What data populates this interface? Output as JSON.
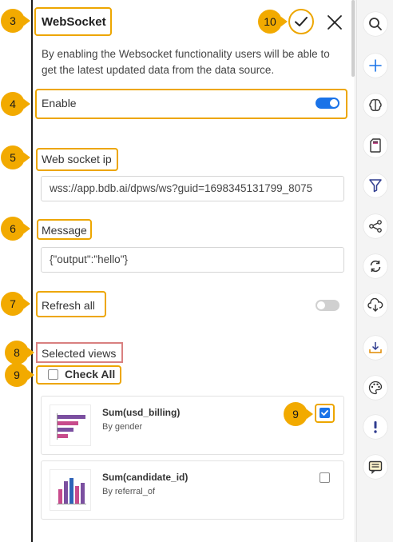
{
  "panel": {
    "title": "WebSocket",
    "description": "By enabling the Websocket functionality users will be able to get the latest updated data from the data source.",
    "enable_label": "Enable",
    "enable_on": true,
    "websocket_ip_label": "Web socket ip",
    "websocket_ip_value": "wss://app.bdb.ai/dpws/ws?guid=1698345131799_8075",
    "message_label": "Message",
    "message_value": "{\"output\":\"hello\"}",
    "refresh_all_label": "Refresh all",
    "refresh_all_on": false,
    "selected_views_label": "Selected views",
    "check_all_label": "Check All",
    "views": [
      {
        "title": "Sum(usd_billing)",
        "subtitle": "By gender",
        "checked": true
      },
      {
        "title": "Sum(candidate_id)",
        "subtitle": "By referral_of",
        "checked": false
      }
    ]
  },
  "callouts": [
    "3",
    "10",
    "4",
    "5",
    "6",
    "7",
    "8",
    "9",
    "9"
  ],
  "rail": {
    "icons": [
      "search-icon",
      "plus-icon",
      "brain-icon",
      "sd-card-icon",
      "filter-icon",
      "share-icon",
      "refresh-icon",
      "cloud-download-icon",
      "download-icon",
      "palette-icon",
      "exclamation-icon",
      "comment-icon"
    ]
  },
  "colors": {
    "accent": "#1a73e8",
    "callout": "#f2aa00",
    "highlight": "#eda600",
    "highlight_red": "#d98080"
  }
}
